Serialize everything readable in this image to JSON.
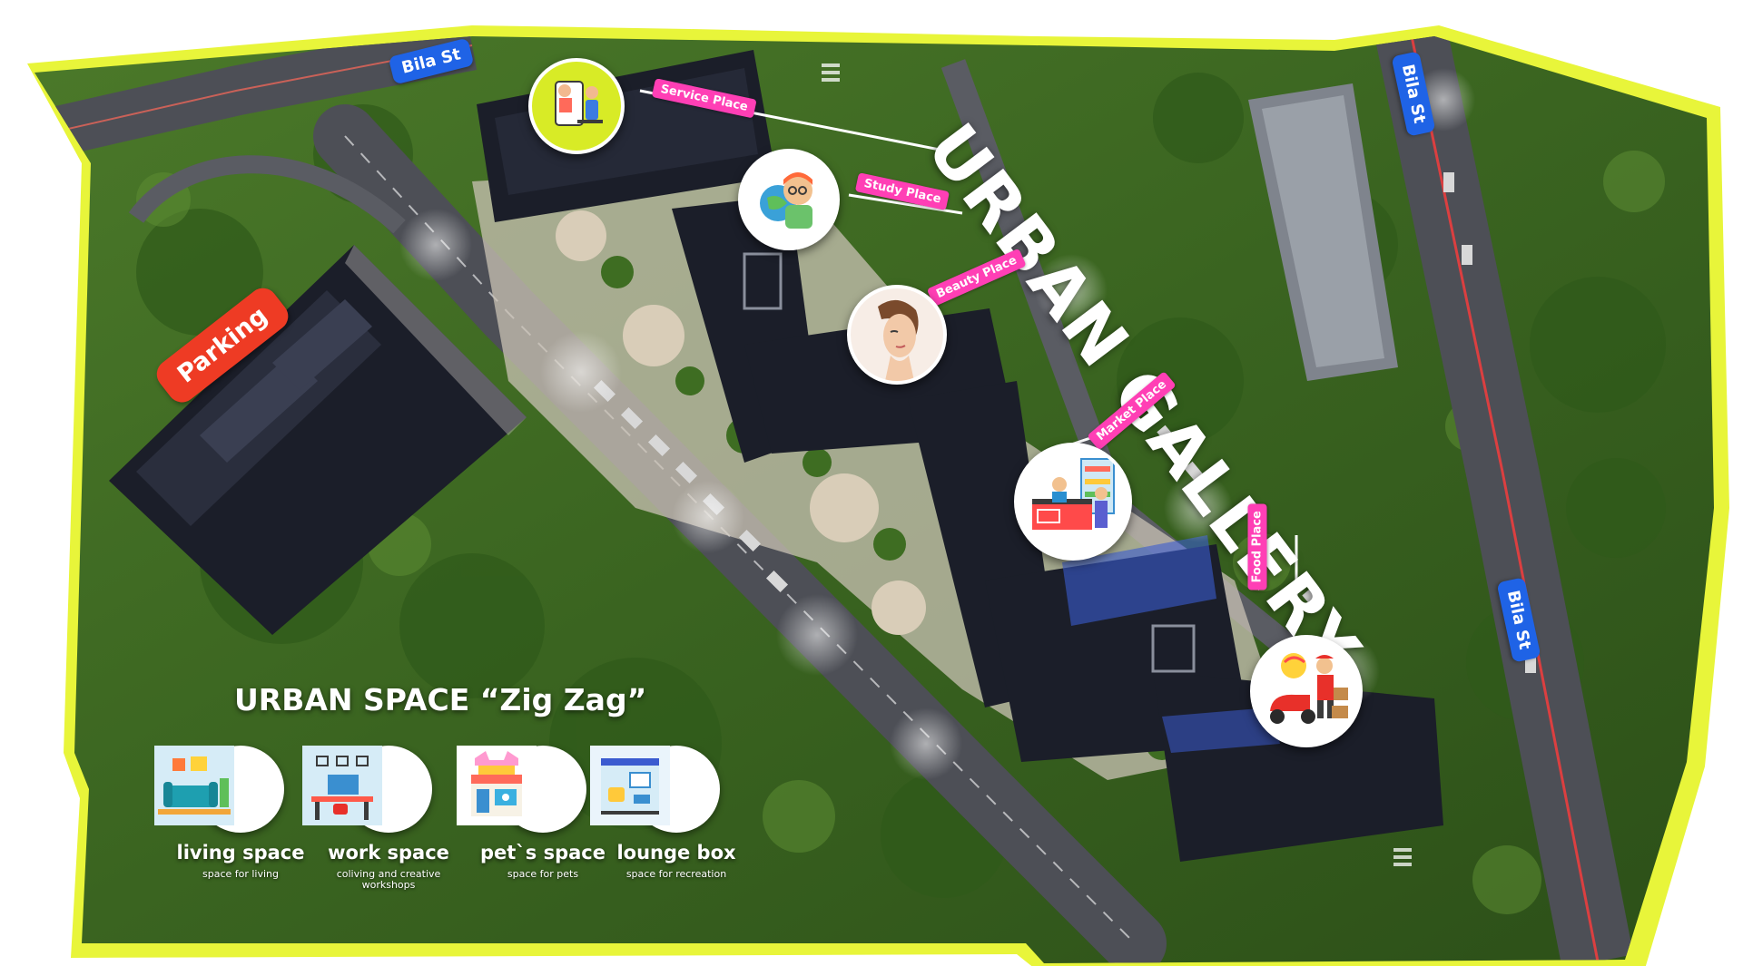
{
  "title": "URBAN GALLERY",
  "space": {
    "title": "URBAN SPACE “Zig Zag”",
    "items": [
      {
        "label": "living space",
        "desc": "space for living",
        "icon": "living-room-icon"
      },
      {
        "label": "work space",
        "desc": "coliving and creative workshops",
        "icon": "workspace-desk-icon"
      },
      {
        "label": "pet`s space",
        "desc": "space for pets",
        "icon": "pet-shop-icon"
      },
      {
        "label": "lounge box",
        "desc": "space for recreation",
        "icon": "lounge-room-icon"
      }
    ]
  },
  "places": [
    {
      "label": "Service Place",
      "icon": "service-person-icon"
    },
    {
      "label": "Study Place",
      "icon": "student-globe-icon"
    },
    {
      "label": "Beauty Place",
      "icon": "beauty-face-icon"
    },
    {
      "label": "Market Place",
      "icon": "market-checkout-icon"
    },
    {
      "label": "Food Place",
      "icon": "food-delivery-icon"
    }
  ],
  "streets": {
    "top_left": "Bila St",
    "top_right": "Bila St",
    "right": "Bila St"
  },
  "parking": "Parking",
  "colors": {
    "border_yellow": "#e8f53a",
    "tag_pink": "#ff3fb5",
    "street_blue": "#1f63e6",
    "parking_red": "#ee3b24",
    "grass": "#3d6a22",
    "building": "#1c1f2c"
  }
}
